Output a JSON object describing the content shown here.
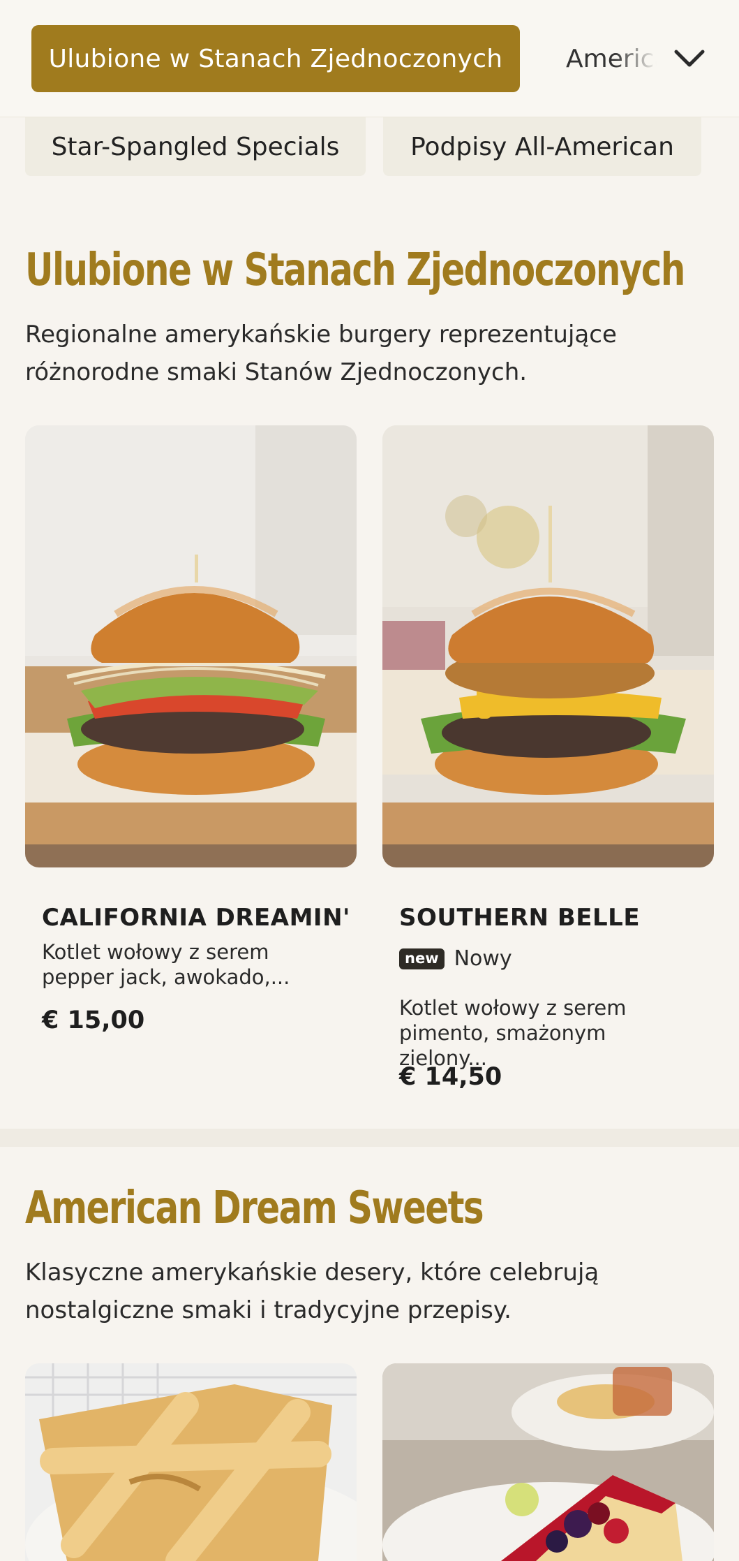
{
  "nav": {
    "active_category": "Ulubione w Stanach Zjednoczonych",
    "next_category": "American Dream Sweets",
    "chips": [
      "Star-Spangled Specials",
      "Podpisy All-American"
    ]
  },
  "sections": [
    {
      "title": "Ulubione w Stanach Zjednoczonych",
      "description": "Regionalne amerykańskie burgery reprezentujące różnorodne smaki Stanów Zjednoczonych.",
      "items": [
        {
          "name": "CALIFORNIA DREAMIN'",
          "description": "Kotlet wołowy z serem pepper jack, awokado,...",
          "price": "€ 15,00",
          "image_icon": "burger-sprouts-avocado"
        },
        {
          "name": "SOUTHERN BELLE",
          "badge": "new",
          "badge_label": "Nowy",
          "description": "Kotlet wołowy z serem pimento, smażonym zielony...",
          "price": "€ 14,50",
          "image_icon": "burger-fried-green-tomato"
        }
      ]
    },
    {
      "title": "American Dream Sweets",
      "description": "Klasyczne amerykańskie desery, które celebrują nostalgiczne smaki i tradycyjne przepisy.",
      "items": [
        {
          "image_icon": "apple-pie-slice"
        },
        {
          "image_icon": "cheesecake-berries"
        }
      ]
    }
  ],
  "colors": {
    "accent": "#a07b1e",
    "background": "#f7f4ef",
    "chip_bg": "#efece2",
    "badge_bg": "#2e2b25"
  }
}
